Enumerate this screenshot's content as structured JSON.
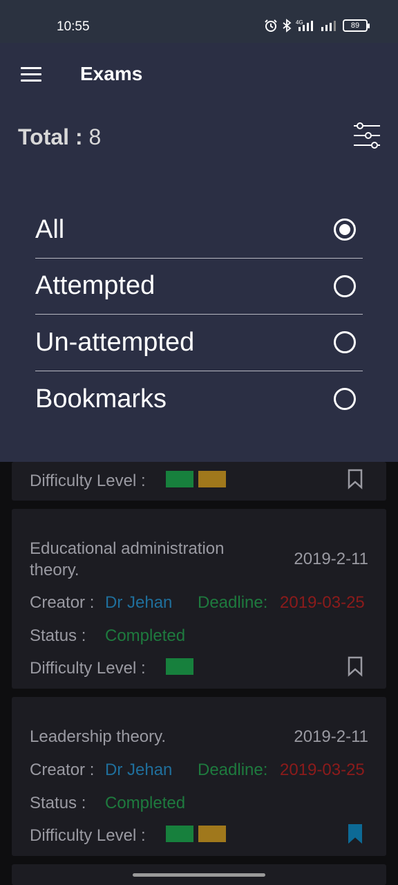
{
  "status": {
    "time": "10:55",
    "battery": "89",
    "network": "4G"
  },
  "header": {
    "title": "Exams"
  },
  "summary": {
    "total_label": "Total :",
    "total_value": "8"
  },
  "filter_options": [
    {
      "label": "All",
      "selected": true
    },
    {
      "label": "Attempted",
      "selected": false
    },
    {
      "label": "Un-attempted",
      "selected": false
    },
    {
      "label": "Bookmarks",
      "selected": false
    }
  ],
  "exams": [
    {
      "difficulty_label": "Difficulty Level :",
      "difficulty": [
        "green",
        "gold"
      ],
      "bookmarked": false
    },
    {
      "title_line1": "Educational administration",
      "title_line2": "theory.",
      "date": "2019-2-11",
      "creator_label": "Creator :",
      "creator": "Dr Jehan",
      "deadline_label": "Deadline:",
      "deadline": "2019-03-25",
      "status_label": "Status :",
      "status": "Completed",
      "difficulty_label": "Difficulty Level :",
      "difficulty": [
        "green"
      ],
      "bookmarked": false
    },
    {
      "title_line1": "Leadership theory.",
      "date": "2019-2-11",
      "creator_label": "Creator :",
      "creator": "Dr Jehan",
      "deadline_label": "Deadline:",
      "deadline": "2019-03-25",
      "status_label": "Status :",
      "status": "Completed",
      "difficulty_label": "Difficulty Level :",
      "difficulty": [
        "green",
        "gold"
      ],
      "bookmarked": true
    }
  ],
  "colors": {
    "creator": "#1f6f9c",
    "deadline_label": "#1e7a3e",
    "deadline": "#8c1b1b",
    "status": "#1e7a3e",
    "diff_green": "#17803d",
    "diff_gold": "#a0781c",
    "bookmark_active": "#0d6a96"
  }
}
